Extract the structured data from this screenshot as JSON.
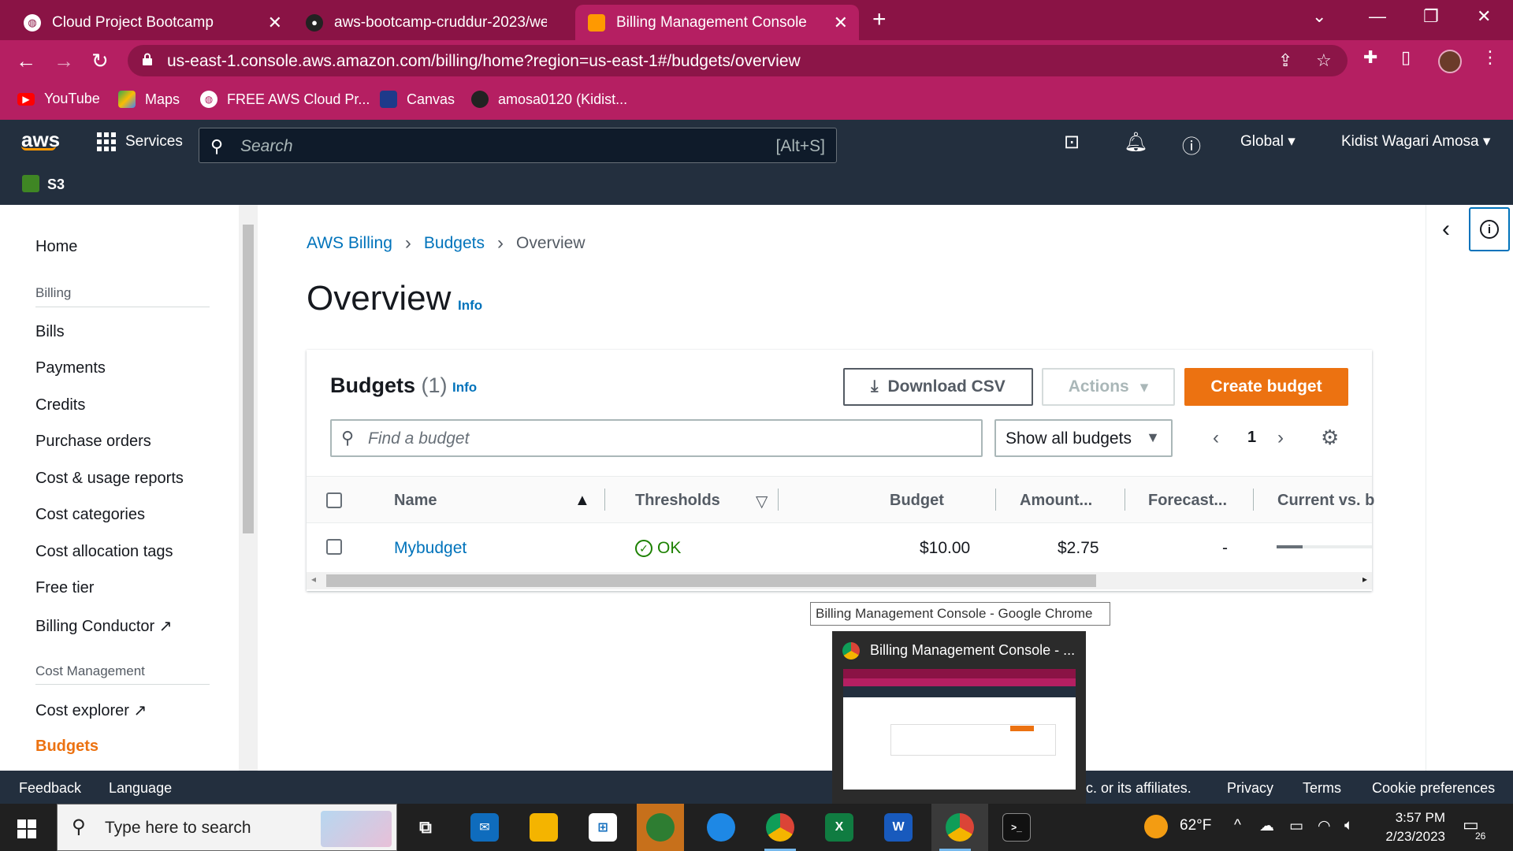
{
  "browser": {
    "tabs": [
      {
        "title": "Cloud Project Bootcamp"
      },
      {
        "title": "aws-bootcamp-cruddur-2023/we"
      },
      {
        "title": "Billing Management Console"
      }
    ],
    "url": "us-east-1.console.aws.amazon.com/billing/home?region=us-east-1#/budgets/overview",
    "bookmarks": [
      {
        "label": "YouTube"
      },
      {
        "label": "Maps"
      },
      {
        "label": "FREE AWS Cloud Pr..."
      },
      {
        "label": "Canvas"
      },
      {
        "label": "amosa0120 (Kidist..."
      }
    ]
  },
  "aws_header": {
    "logo": "aws",
    "services_label": "Services",
    "search_placeholder": "Search",
    "search_shortcut": "[Alt+S]",
    "region": "Global",
    "user": "Kidist Wagari Amosa",
    "favorite_service": "S3"
  },
  "sidebar": {
    "home": "Home",
    "billing_heading": "Billing",
    "billing_items": [
      "Bills",
      "Payments",
      "Credits",
      "Purchase orders",
      "Cost & usage reports",
      "Cost categories",
      "Cost allocation tags",
      "Free tier",
      "Billing Conductor"
    ],
    "cost_mgmt_heading": "Cost Management",
    "cost_items": [
      "Cost explorer",
      "Budgets"
    ]
  },
  "breadcrumb": {
    "items": [
      "AWS Billing",
      "Budgets",
      "Overview"
    ]
  },
  "page": {
    "title": "Overview",
    "info": "Info"
  },
  "budgets_card": {
    "title": "Budgets",
    "count": "(1)",
    "info": "Info",
    "download_csv": "Download CSV",
    "actions": "Actions",
    "create_budget": "Create budget",
    "find_placeholder": "Find a budget",
    "filter_value": "Show all budgets",
    "page_number": "1",
    "columns": [
      "Name",
      "Thresholds",
      "Budget",
      "Amount...",
      "Forecast...",
      "Current vs. b"
    ],
    "rows": [
      {
        "name": "Mybudget",
        "threshold": "OK",
        "budget": "$10.00",
        "amount": "$2.75",
        "forecast": "-",
        "current_vs_budget": 0.275
      }
    ]
  },
  "tooltip": "Billing Management Console - Google Chrome",
  "preview_title": "Billing Management Console - ...",
  "footer": {
    "feedback": "Feedback",
    "language": "Language",
    "copyright": "c. or its affiliates.",
    "privacy": "Privacy",
    "terms": "Terms",
    "cookie": "Cookie preferences"
  },
  "taskbar": {
    "search_placeholder": "Type here to search",
    "weather": "62°F",
    "time": "3:57 PM",
    "date": "2/23/2023",
    "notification_count": "26"
  },
  "colors": {
    "chrome_frame": "#8a1345",
    "chrome_toolbar": "#b51f62",
    "aws_nav": "#232f3e",
    "aws_orange": "#ec7211",
    "link_blue": "#0073bb",
    "ok_green": "#1d8102"
  }
}
